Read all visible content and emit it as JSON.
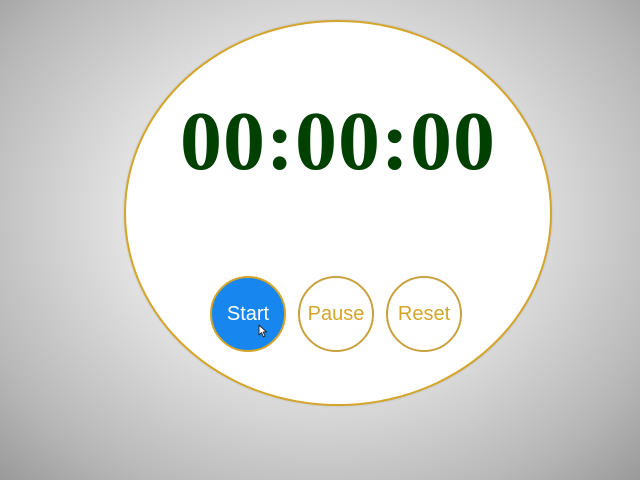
{
  "stopwatch": {
    "time": "00:00:00",
    "buttons": {
      "start": "Start",
      "pause": "Pause",
      "reset": "Reset"
    }
  },
  "colors": {
    "ring": "#d4a52a",
    "time_text": "#004000",
    "start_bg": "#1787ef",
    "button_text": "#d4a52a"
  },
  "icons": {
    "cursor": "mouse-pointer-icon"
  }
}
